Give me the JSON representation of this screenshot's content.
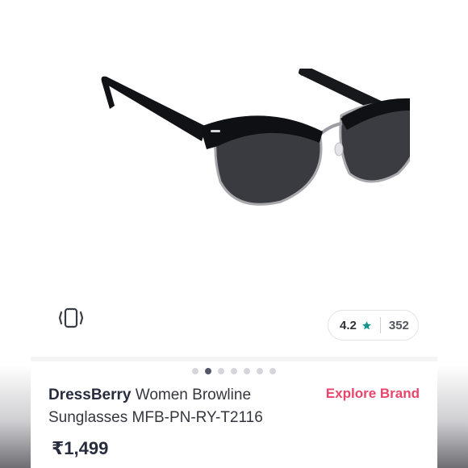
{
  "product": {
    "brand": "DressBerry",
    "name": "Women Browline",
    "name_line2": "Sunglasses MFB-PN-RY-T2116",
    "price": "₹1,499",
    "explore_label": "Explore Brand"
  },
  "rating": {
    "value": "4.2",
    "count": "352"
  },
  "carousel": {
    "total_dots": 7,
    "active_index": 1
  },
  "colors": {
    "accent": "#e8456b",
    "star": "#14958f",
    "text_dark": "#282c3f"
  },
  "icons": {
    "view_mode": "vibrate-icon",
    "rating": "star-icon"
  }
}
